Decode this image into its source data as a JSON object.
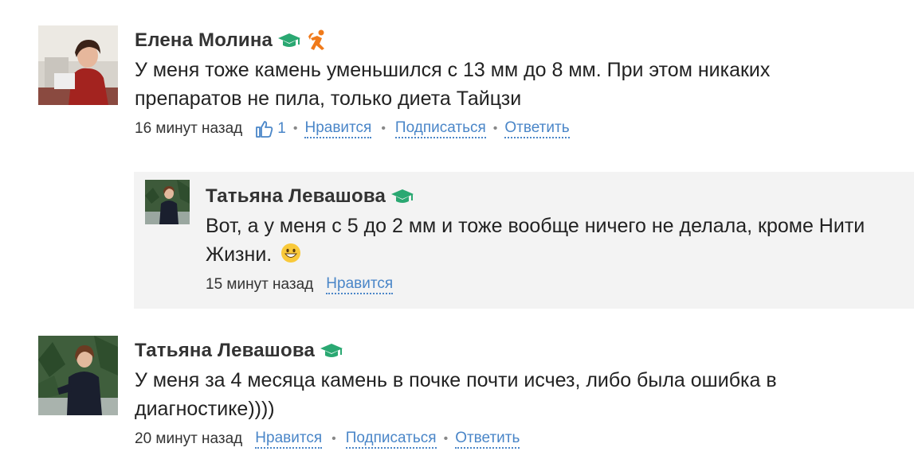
{
  "comments": [
    {
      "author": "Елена Молина",
      "badges": [
        "graduation-cap-icon",
        "runner-icon"
      ],
      "text": "У меня тоже камень уменьшился с 13 мм до 8 мм. При этом никаких препаратов не пила, только диета Тайцзи",
      "time": "16 минут назад",
      "likes": "1",
      "like_label": "Нравится",
      "subscribe_label": "Подписаться",
      "reply_label": "Ответить"
    },
    {
      "author": "Татьяна Левашова",
      "badges": [
        "graduation-cap-icon"
      ],
      "text": "Вот, а у меня с 5 до 2 мм и тоже вообще ничего не делала, кроме Нити Жизни.",
      "emoji": "grinning-face-icon",
      "time": "15 минут назад",
      "like_label": "Нравится"
    },
    {
      "author": "Татьяна Левашова",
      "badges": [
        "graduation-cap-icon"
      ],
      "text": "У меня за 4 месяца камень в почке почти исчез, либо была ошибка в диагностике))))",
      "time": "20 минут назад",
      "like_label": "Нравится",
      "subscribe_label": "Подписаться",
      "reply_label": "Ответить"
    }
  ],
  "colors": {
    "link": "#4a86c8",
    "badge_green": "#2aa872",
    "badge_orange": "#f07a1a",
    "reply_background": "#f3f3f3"
  }
}
